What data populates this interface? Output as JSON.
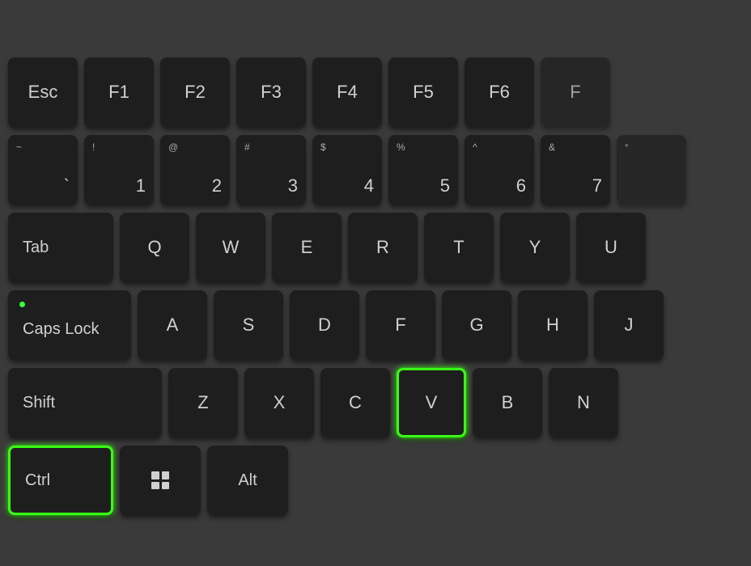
{
  "keyboard": {
    "background": "#3a3a3a",
    "rows": [
      {
        "id": "function-row",
        "keys": [
          {
            "id": "esc",
            "label": "Esc",
            "wide": false
          },
          {
            "id": "f1",
            "label": "F1"
          },
          {
            "id": "f2",
            "label": "F2"
          },
          {
            "id": "f3",
            "label": "F3"
          },
          {
            "id": "f4",
            "label": "F4"
          },
          {
            "id": "f5",
            "label": "F5"
          },
          {
            "id": "f6",
            "label": "F6"
          },
          {
            "id": "f7-partial",
            "label": "F",
            "partial": true
          }
        ]
      },
      {
        "id": "number-row",
        "keys": [
          {
            "id": "backtick",
            "top": "~",
            "bottom": "`"
          },
          {
            "id": "1",
            "top": "!",
            "bottom": "1"
          },
          {
            "id": "2",
            "top": "@",
            "bottom": "2"
          },
          {
            "id": "3",
            "top": "#",
            "bottom": "3"
          },
          {
            "id": "4",
            "top": "$",
            "bottom": "4"
          },
          {
            "id": "5",
            "top": "%",
            "bottom": "5"
          },
          {
            "id": "6",
            "top": "^",
            "bottom": "6"
          },
          {
            "id": "7",
            "top": "&",
            "bottom": "7"
          },
          {
            "id": "8-partial",
            "top": "*",
            "partial": true
          }
        ]
      },
      {
        "id": "qwerty-row",
        "keys": [
          {
            "id": "tab",
            "label": "Tab",
            "wide": "tab"
          },
          {
            "id": "q",
            "label": "Q"
          },
          {
            "id": "w",
            "label": "W"
          },
          {
            "id": "e",
            "label": "E"
          },
          {
            "id": "r",
            "label": "R"
          },
          {
            "id": "t",
            "label": "T"
          },
          {
            "id": "y",
            "label": "Y"
          },
          {
            "id": "u",
            "label": "U"
          }
        ]
      },
      {
        "id": "asdf-row",
        "keys": [
          {
            "id": "caps",
            "label": "Caps Lock",
            "wide": "caps",
            "dot": true
          },
          {
            "id": "a",
            "label": "A"
          },
          {
            "id": "s",
            "label": "S"
          },
          {
            "id": "d",
            "label": "D"
          },
          {
            "id": "f",
            "label": "F"
          },
          {
            "id": "g",
            "label": "G"
          },
          {
            "id": "h",
            "label": "H"
          },
          {
            "id": "j",
            "label": "J"
          }
        ]
      },
      {
        "id": "zxcv-row",
        "keys": [
          {
            "id": "shift",
            "label": "Shift",
            "wide": "shift"
          },
          {
            "id": "z",
            "label": "Z"
          },
          {
            "id": "x",
            "label": "X"
          },
          {
            "id": "c",
            "label": "C"
          },
          {
            "id": "v",
            "label": "V",
            "highlighted": true
          },
          {
            "id": "b",
            "label": "B"
          },
          {
            "id": "n",
            "label": "N"
          }
        ]
      },
      {
        "id": "bottom-row",
        "keys": [
          {
            "id": "ctrl",
            "label": "Ctrl",
            "wide": "ctrl",
            "highlighted": true
          },
          {
            "id": "win",
            "label": "win",
            "wide": "win"
          },
          {
            "id": "alt",
            "label": "Alt",
            "wide": "alt"
          }
        ]
      }
    ]
  }
}
